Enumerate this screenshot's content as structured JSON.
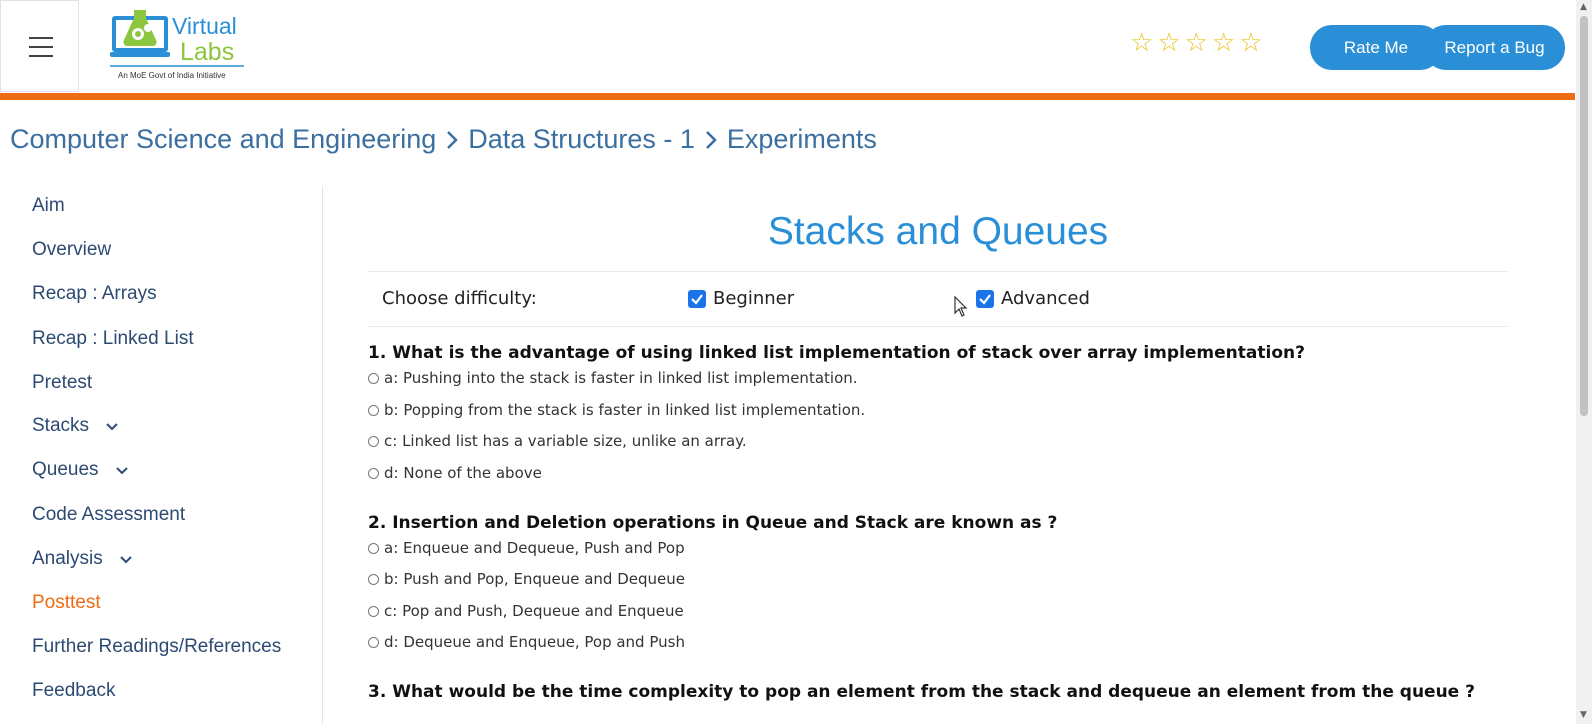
{
  "header": {
    "logo": {
      "line1": "Virtual",
      "line2": "Labs",
      "tagline": "An MoE Govt of India Initiative"
    },
    "stars": [
      "☆",
      "☆",
      "☆",
      "☆",
      "☆"
    ],
    "rate_label": "Rate Me",
    "bug_label": "Report a Bug",
    "accent_color": "#ee6c14",
    "button_color": "#2a8fd6"
  },
  "breadcrumb": [
    "Computer Science and Engineering",
    "Data Structures - 1",
    "Experiments"
  ],
  "sidebar": {
    "items": [
      {
        "label": "Aim"
      },
      {
        "label": "Overview"
      },
      {
        "label": "Recap : Arrays"
      },
      {
        "label": "Recap : Linked List"
      },
      {
        "label": "Pretest"
      },
      {
        "label": "Stacks",
        "expandable": true
      },
      {
        "label": "Queues",
        "expandable": true
      },
      {
        "label": "Code Assessment"
      },
      {
        "label": "Analysis",
        "expandable": true
      },
      {
        "label": "Posttest",
        "active": true
      },
      {
        "label": "Further Readings/References"
      },
      {
        "label": "Feedback"
      }
    ]
  },
  "main": {
    "title": "Stacks and Queues",
    "difficulty": {
      "label": "Choose difficulty:",
      "options": [
        {
          "label": "Beginner",
          "checked": true
        },
        {
          "label": "Advanced",
          "checked": true
        }
      ]
    },
    "questions": [
      {
        "text": "1. What is the advantage of using linked list implementation of stack over array implementation?",
        "options": [
          "a: Pushing into the stack is faster in linked list implementation.",
          "b: Popping from the stack is faster in linked list implementation.",
          "c: Linked list has a variable size, unlike an array.",
          "d: None of the above"
        ]
      },
      {
        "text": "2. Insertion and Deletion operations in Queue and Stack are known as ?",
        "options": [
          "a: Enqueue and Dequeue, Push and Pop",
          "b: Push and Pop, Enqueue and Dequeue",
          "c: Pop and Push, Dequeue and Enqueue",
          "d: Dequeue and Enqueue, Pop and Push"
        ]
      },
      {
        "text": "3. What would be the time complexity to pop an element from the stack and dequeue an element from the queue ?",
        "options": []
      }
    ]
  }
}
